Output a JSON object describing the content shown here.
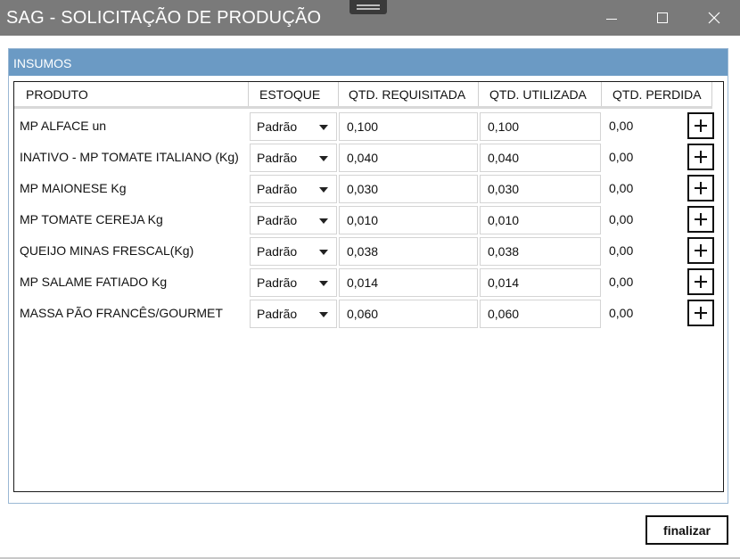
{
  "window": {
    "title": "SAG - SOLICITAÇÃO DE PRODUÇÃO",
    "controls": [
      "minimize-icon",
      "maximize-icon",
      "close-icon"
    ]
  },
  "group": {
    "title": "INSUMOS"
  },
  "table": {
    "columns": [
      "PRODUTO",
      "ESTOQUE",
      "QTD. REQUISITADA",
      "QTD. UTILIZADA",
      "QTD. PERDIDA"
    ],
    "rows": [
      {
        "produto": "MP ALFACE un",
        "estoque": "Padrão",
        "requisitada": "0,100",
        "utilizada": "0,100",
        "perdida": "0,00"
      },
      {
        "produto": "INATIVO - MP TOMATE ITALIANO (Kg)",
        "estoque": "Padrão",
        "requisitada": "0,040",
        "utilizada": "0,040",
        "perdida": "0,00"
      },
      {
        "produto": "MP MAIONESE Kg",
        "estoque": "Padrão",
        "requisitada": "0,030",
        "utilizada": "0,030",
        "perdida": "0,00"
      },
      {
        "produto": "MP TOMATE CEREJA Kg",
        "estoque": "Padrão",
        "requisitada": "0,010",
        "utilizada": "0,010",
        "perdida": "0,00"
      },
      {
        "produto": "QUEIJO MINAS FRESCAL(Kg)",
        "estoque": "Padrão",
        "requisitada": "0,038",
        "utilizada": "0,038",
        "perdida": "0,00"
      },
      {
        "produto": "MP SALAME FATIADO Kg",
        "estoque": "Padrão",
        "requisitada": "0,014",
        "utilizada": "0,014",
        "perdida": "0,00"
      },
      {
        "produto": "MASSA PÃO FRANCÊS/GOURMET",
        "estoque": "Padrão",
        "requisitada": "0,060",
        "utilizada": "0,060",
        "perdida": "0,00"
      }
    ]
  },
  "actions": {
    "finalizar": "finalizar"
  },
  "colors": {
    "titlebar": "#7a7a7a",
    "group_header": "#6b9ac4"
  }
}
